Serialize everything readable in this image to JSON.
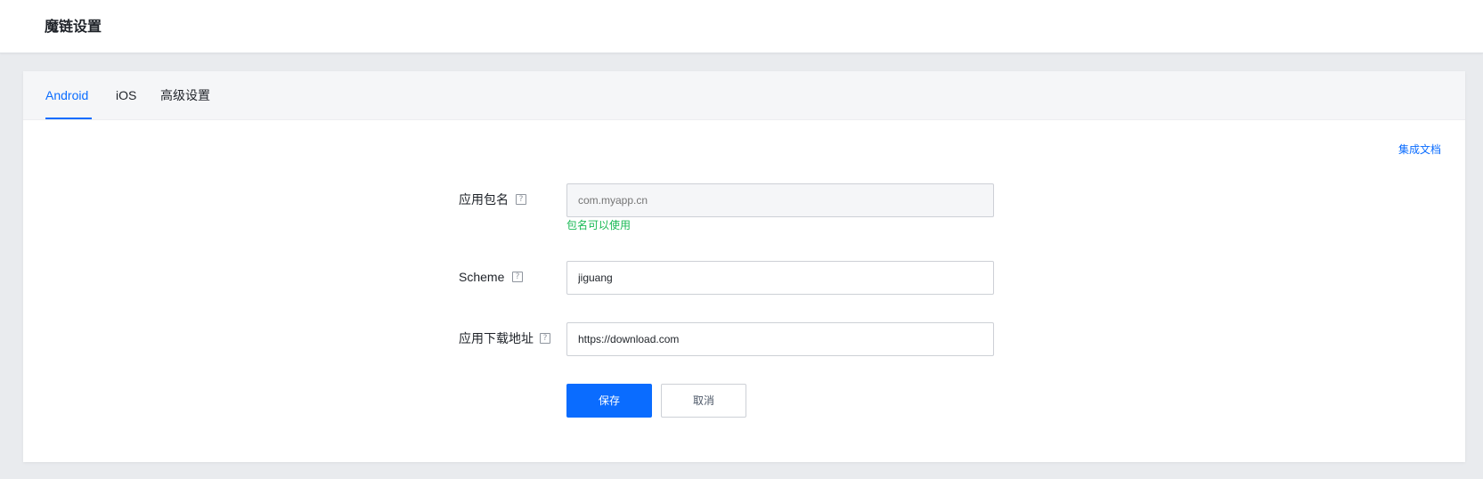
{
  "header": {
    "title": "魔链设置"
  },
  "tabs": [
    {
      "label": "Android",
      "active": true
    },
    {
      "label": "iOS",
      "active": false
    },
    {
      "label": "高级设置",
      "active": false
    }
  ],
  "doc_link": "集成文档",
  "form": {
    "package": {
      "label": "应用包名",
      "placeholder": "com.myapp.cn",
      "value": "",
      "status": "包名可以使用"
    },
    "scheme": {
      "label": "Scheme",
      "value": "jiguang"
    },
    "download": {
      "label": "应用下载地址",
      "value": "https://download.com"
    },
    "help_glyph": "?"
  },
  "buttons": {
    "save": "保存",
    "cancel": "取消"
  },
  "colors": {
    "accent": "#0a6cff",
    "success": "#19b955",
    "background": "#e9ebee"
  }
}
